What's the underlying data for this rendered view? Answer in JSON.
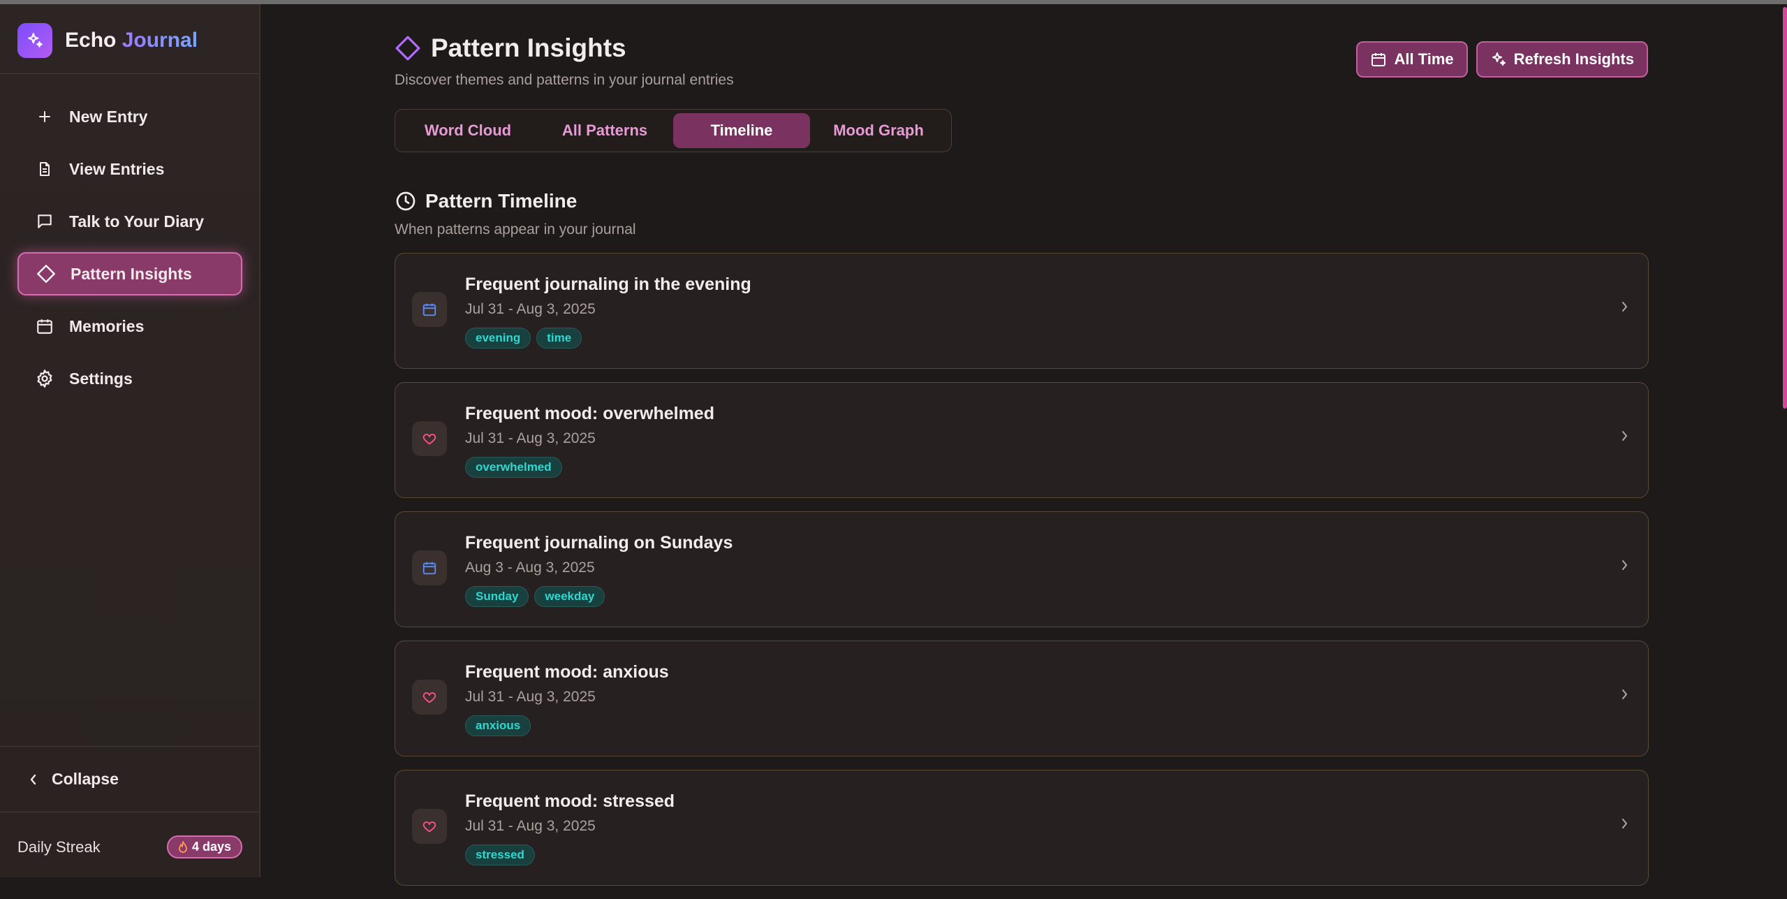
{
  "app": {
    "name_part1": "Echo",
    "name_part2": "Journal",
    "accent": "#d46fae",
    "brand_gradient": [
      "#7c4dff",
      "#b25cf0"
    ]
  },
  "sidebar": {
    "items": [
      {
        "label": "New Entry",
        "icon": "plus-icon"
      },
      {
        "label": "View Entries",
        "icon": "document-icon"
      },
      {
        "label": "Talk to Your Diary",
        "icon": "chat-icon"
      },
      {
        "label": "Pattern Insights",
        "icon": "diamond-icon",
        "active": true
      },
      {
        "label": "Memories",
        "icon": "calendar-icon"
      },
      {
        "label": "Settings",
        "icon": "gear-icon"
      }
    ],
    "collapse_label": "Collapse",
    "streak_label": "Daily Streak",
    "streak_value": "4 days"
  },
  "header": {
    "title": "Pattern Insights",
    "subtitle": "Discover themes and patterns in your journal entries",
    "all_time_label": "All Time",
    "refresh_label": "Refresh Insights"
  },
  "tabs": [
    {
      "label": "Word Cloud"
    },
    {
      "label": "All Patterns"
    },
    {
      "label": "Timeline",
      "active": true
    },
    {
      "label": "Mood Graph"
    }
  ],
  "section": {
    "title": "Pattern Timeline",
    "subtitle": "When patterns appear in your journal"
  },
  "patterns": [
    {
      "title": "Frequent journaling in the evening",
      "date": "Jul 31 - Aug 3, 2025",
      "icon": "calendar-icon",
      "tags": [
        "evening",
        "time"
      ]
    },
    {
      "title": "Frequent mood: overwhelmed",
      "date": "Jul 31 - Aug 3, 2025",
      "icon": "heart-icon",
      "tags": [
        "overwhelmed"
      ]
    },
    {
      "title": "Frequent journaling on Sundays",
      "date": "Aug 3 - Aug 3, 2025",
      "icon": "calendar-icon",
      "tags": [
        "Sunday",
        "weekday"
      ]
    },
    {
      "title": "Frequent mood: anxious",
      "date": "Jul 31 - Aug 3, 2025",
      "icon": "heart-icon",
      "tags": [
        "anxious"
      ]
    },
    {
      "title": "Frequent mood: stressed",
      "date": "Jul 31 - Aug 3, 2025",
      "icon": "heart-icon",
      "tags": [
        "stressed"
      ]
    }
  ]
}
